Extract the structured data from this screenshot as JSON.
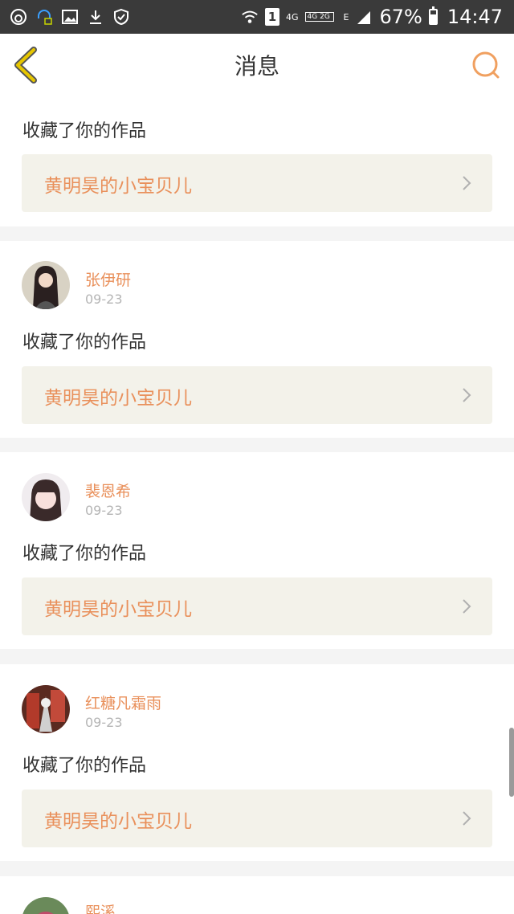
{
  "status_bar": {
    "battery": "67%",
    "time": "14:47",
    "network_4g": "4G",
    "network_dual": "4G 2G",
    "network_e": "E",
    "sim_slot": "1",
    "battery_level": 0.67
  },
  "header": {
    "title": "消息"
  },
  "messages": [
    {
      "action": "收藏了你的作品",
      "work_title": "黄明昊的小宝贝儿"
    },
    {
      "username": "张伊研",
      "date": "09-23",
      "action": "收藏了你的作品",
      "work_title": "黄明昊的小宝贝儿"
    },
    {
      "username": "裴恩希",
      "date": "09-23",
      "action": "收藏了你的作品",
      "work_title": "黄明昊的小宝贝儿"
    },
    {
      "username": "红糖凡霜雨",
      "date": "09-23",
      "action": "收藏了你的作品",
      "work_title": "黄明昊的小宝贝儿"
    },
    {
      "username": "熙溪"
    }
  ],
  "colors": {
    "accent": "#e9905b",
    "back_icon": "#e6b800",
    "status_bar": "#3a3a3a",
    "card_box": "#f3f2ea"
  }
}
